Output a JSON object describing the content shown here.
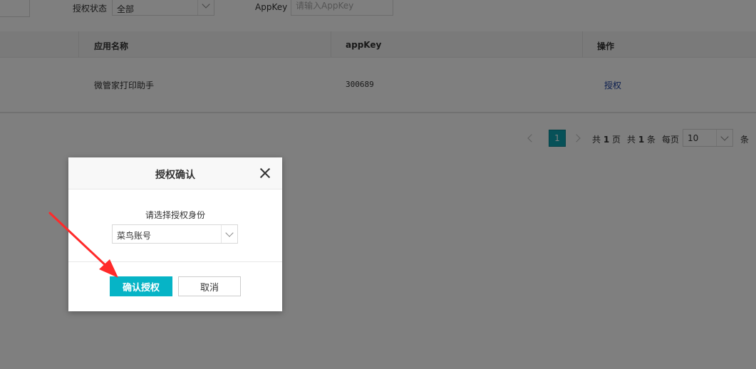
{
  "filter": {
    "auth_status_label": "授权状态",
    "auth_status_value": "全部",
    "appkey_label": "AppKey",
    "appkey_placeholder": "请输入AppKey"
  },
  "table": {
    "headers": [
      "应用名称",
      "appKey",
      "操作"
    ],
    "rows": [
      {
        "app_name": "微管家打印助手",
        "app_key": "300689",
        "action": "授权"
      }
    ]
  },
  "pagination": {
    "current_page": "1",
    "total_pages_prefix": "共",
    "total_pages": "1",
    "total_pages_suffix": "页",
    "total_items_prefix": "共",
    "total_items": "1",
    "total_items_suffix": "条",
    "per_page_label": "每页",
    "per_page_value": "10",
    "per_page_suffix": "条"
  },
  "modal": {
    "title": "授权确认",
    "prompt": "请选择授权身份",
    "identity_value": "菜鸟账号",
    "confirm_label": "确认授权",
    "cancel_label": "取消"
  },
  "colors": {
    "accent": "#06b4c6",
    "annotation_arrow": "#ff2a2a",
    "link": "#1a3f9e"
  }
}
